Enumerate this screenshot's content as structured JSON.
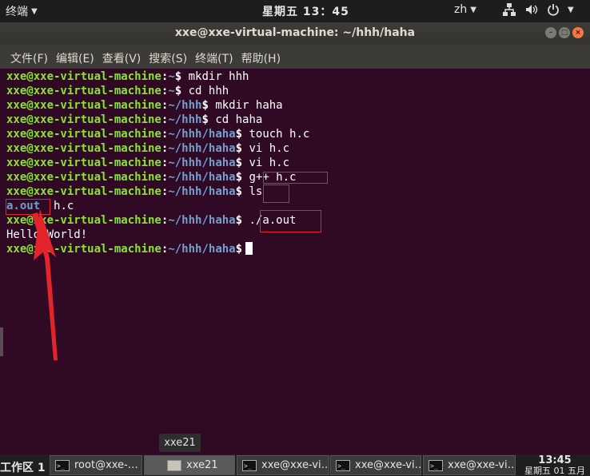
{
  "topbar": {
    "app_name": "终端",
    "clock": "星期五 13：45",
    "language": "zh",
    "tray_icons": [
      "network-icon",
      "volume-icon",
      "power-icon"
    ]
  },
  "window": {
    "title": "xxe@xxe-virtual-machine: ~/hhh/haha"
  },
  "menu": {
    "items": [
      "文件(F)",
      "编辑(E)",
      "查看(V)",
      "搜索(S)",
      "终端(T)",
      "帮助(H)"
    ]
  },
  "terminal": {
    "user": "xxe@xxe-virtual-machine",
    "lines": [
      {
        "path": "~",
        "cmd": "mkdir hhh"
      },
      {
        "path": "~",
        "cmd": "cd hhh"
      },
      {
        "path": "~/hhh",
        "cmd": "mkdir haha"
      },
      {
        "path": "~/hhh",
        "cmd": "cd haha"
      },
      {
        "path": "~/hhh/haha",
        "cmd": "touch h.c"
      },
      {
        "path": "~/hhh/haha",
        "cmd": "vi h.c"
      },
      {
        "path": "~/hhh/haha",
        "cmd": "vi h.c"
      },
      {
        "path": "~/hhh/haha",
        "cmd": "g++ h.c"
      },
      {
        "path": "~/hhh/haha",
        "cmd": "ls"
      },
      {
        "output_file1": "a.out",
        "output_file2": "h.c"
      },
      {
        "path": "~/hhh/haha",
        "cmd": "./a.out"
      },
      {
        "output": "Hello World!"
      },
      {
        "path": "~/hhh/haha",
        "cmd": ""
      }
    ]
  },
  "tooltip": "xxe21",
  "taskbar": {
    "workspace": "工作区 1",
    "tasks": [
      {
        "label": "root@xxe-…",
        "icon": "terminal-icon"
      },
      {
        "label": "xxe21",
        "icon": "file-manager-icon"
      },
      {
        "label": "xxe@xxe-vi…",
        "icon": "terminal-icon"
      },
      {
        "label": "xxe@xxe-vi…",
        "icon": "terminal-icon"
      },
      {
        "label": "xxe@xxe-vi…",
        "icon": "terminal-icon"
      }
    ],
    "time": "13:45",
    "date": "星期五 01 五月"
  },
  "colors": {
    "terminal_bg": "#300a24",
    "user_green": "#8ae234",
    "path_blue": "#729fcf",
    "annotation_red": "#e3242b"
  }
}
